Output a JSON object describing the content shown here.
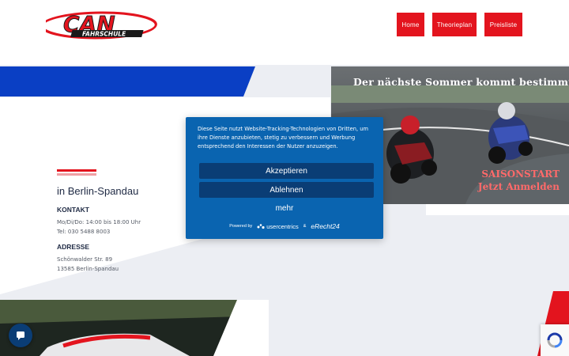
{
  "colors": {
    "brand_red": "#e3141e",
    "brand_blue": "#0a3fc4",
    "modal_blue": "#0a64b0",
    "modal_button": "#0a3d75",
    "text_dark": "#1f2a44"
  },
  "logo": {
    "main": "CAN",
    "sub": "FAHRSCHULE"
  },
  "nav": {
    "items": [
      {
        "label": "Home"
      },
      {
        "label": "Theorieplan"
      },
      {
        "label": "Preisliste"
      }
    ]
  },
  "hero": {
    "title": "Der nächste Sommer kommt bestimmt!",
    "promo_line1": "SAISONSTART",
    "promo_line2": "Jetzt Anmelden"
  },
  "contact": {
    "city": "in Berlin-Spandau",
    "kontakt_heading": "KONTAKT",
    "hours": "Mo/Di/Do: 14:00 bis 18:00 Uhr",
    "phone": "Tel: 030 5488 8003",
    "adresse_heading": "ADRESSE",
    "street": "Schönwalder Str. 89",
    "zip_city": "13585 Berlin-Spandau"
  },
  "cookie": {
    "text": "Diese Seite nutzt Website-Tracking-Technologien von Dritten, um ihre Dienste anzubieten, stetig zu verbessern und Werbung entsprechend den Interessen der Nutzer anzuzeigen.",
    "accept_label": "Akzeptieren",
    "decline_label": "Ablehnen",
    "more_label": "mehr",
    "powered_by": "Powered by",
    "usercentrics": "usercentrics",
    "ampersand": "&",
    "erecht": "eRecht24"
  },
  "icons": {
    "chat": "chat-icon",
    "recaptcha": "recaptcha-icon"
  }
}
